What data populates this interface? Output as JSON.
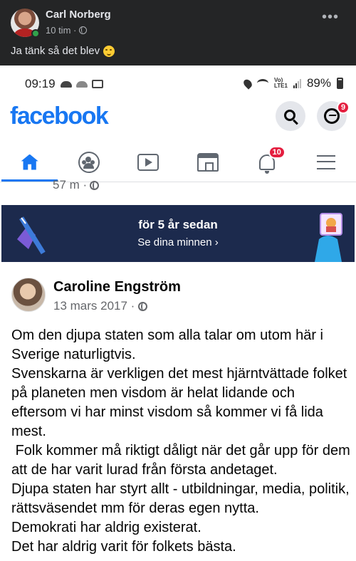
{
  "outer_post": {
    "author": "Carl Norberg",
    "time": "10 tim ·",
    "caption": "Ja tänk så det blev",
    "icons": [
      "avatar",
      "online-dot",
      "globe-icon",
      "more-icon",
      "smirk-emoji"
    ]
  },
  "status_bar": {
    "time": "09:19",
    "lte": "Vo)\nLTE1",
    "battery": "89%",
    "icons": [
      "cloud-icon",
      "cloud-icon",
      "mail-icon",
      "location-icon",
      "wifi-icon",
      "signal-icon",
      "battery-icon"
    ]
  },
  "fb_header": {
    "logo": "facebook",
    "messenger_badge": "9",
    "icons": [
      "search-icon",
      "messenger-icon"
    ]
  },
  "nav": {
    "tabs": [
      {
        "name": "home",
        "icon": "home-icon",
        "active": true
      },
      {
        "name": "groups",
        "icon": "groups-icon"
      },
      {
        "name": "watch",
        "icon": "video-icon"
      },
      {
        "name": "marketplace",
        "icon": "marketplace-icon"
      },
      {
        "name": "notifications",
        "icon": "bell-icon",
        "badge": "10"
      },
      {
        "name": "menu",
        "icon": "menu-icon"
      }
    ],
    "notifications_badge": "10"
  },
  "previous_post": {
    "meta": "57 m ·"
  },
  "memories": {
    "title": "för 5 år sedan",
    "link": "Se dina minnen ›"
  },
  "post": {
    "author": "Caroline Engström",
    "date": "13 mars 2017 ·",
    "text": "Om den djupa staten som alla talar om utom här i Sverige naturligtvis.\nSvenskarna är verkligen det mest hjärntvättade folket på planeten men visdom är helat lidande och eftersom vi har minst visdom så kommer vi få lida mest.\n Folk kommer må riktigt dåligt när det går upp för dem att de har varit lurad från första andetaget.\nDjupa staten har styrt allt - utbildningar, media, politik, rättsväsendet mm för deras egen nytta.\nDemokrati har aldrig existerat.\nDet har aldrig varit för folkets bästa."
  },
  "colors": {
    "fb_blue": "#1877f2",
    "dark_bg": "#242526",
    "badge_red": "#e41e3f",
    "memories_bg": "#1c2a4d"
  }
}
